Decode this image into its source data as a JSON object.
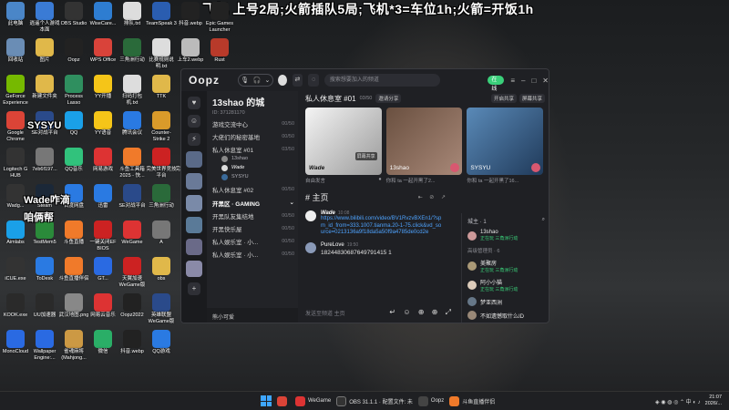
{
  "overlay_text": "飞机 上号2局;火箭插队5局;飞机*3=车位1h;火箭=开饭1h",
  "desktop_icons": [
    {
      "label": "此电脑",
      "color": "#4a86c8"
    },
    {
      "label": "逍遥个人游戏本面",
      "color": "#3a7bd5"
    },
    {
      "label": "OBS Studio",
      "color": "#333"
    },
    {
      "label": "WiseCare...",
      "color": "#2e7dd1"
    },
    {
      "label": "排队.txt",
      "color": "#ddd"
    },
    {
      "label": "TeamSpeak 3",
      "color": "#2a5db0"
    },
    {
      "label": "抖音.webp",
      "color": "#222"
    },
    {
      "label": "Epic Games Launcher",
      "color": "#222"
    },
    {
      "label": "回收站",
      "color": "#6a8db5"
    },
    {
      "label": "图片",
      "color": "#e0b84a"
    },
    {
      "label": "Oopz",
      "color": "#222"
    },
    {
      "label": "WPS Office",
      "color": "#d9433a"
    },
    {
      "label": "三角洲行动",
      "color": "#2a6a3a"
    },
    {
      "label": "比赛规则说明.txt",
      "color": "#ddd"
    },
    {
      "label": "上车2.webp",
      "color": "#bbb"
    },
    {
      "label": "Rust",
      "color": "#b83a2a"
    },
    {
      "label": "GeForce Experience",
      "color": "#76b900"
    },
    {
      "label": "新建文件夹",
      "color": "#e0b84a"
    },
    {
      "label": "Process Lasso",
      "color": "#2f8f5f"
    },
    {
      "label": "YY开播",
      "color": "#f5c518"
    },
    {
      "label": "扫码打包机.txt",
      "color": "#ddd"
    },
    {
      "label": "TTK",
      "color": "#e0b84a"
    },
    {
      "label": "Google Chrome",
      "color": "#db4437"
    },
    {
      "label": "SE对战平台",
      "color": "#2a4a8a"
    },
    {
      "label": "QQ",
      "color": "#1aa0e8"
    },
    {
      "label": "YY语音",
      "color": "#f5c518"
    },
    {
      "label": "腾讯会议",
      "color": "#2a7ae2"
    },
    {
      "label": "Counter-Strike 2",
      "color": "#d99a2a"
    },
    {
      "label": "Logitech G HUB",
      "color": "#333"
    },
    {
      "label": "7eb6f197...",
      "color": "#777"
    },
    {
      "label": "QQ音乐",
      "color": "#31c27c"
    },
    {
      "label": "网易游戏",
      "color": "#d33"
    },
    {
      "label": "斗鱼工具箱 2025 - 快...",
      "color": "#f07a2a"
    },
    {
      "label": "完美世界竞技平台",
      "color": "#c22"
    },
    {
      "label": "完美对战平台",
      "color": "#333"
    },
    {
      "label": "Wadg...",
      "color": "#333"
    },
    {
      "label": "Steam",
      "color": "#1b2838"
    },
    {
      "label": "百度网盘",
      "color": "#2a7ae2"
    },
    {
      "label": "迅雷",
      "color": "#2a7ae2"
    },
    {
      "label": "SE对战平台",
      "color": "#2a4a8a"
    },
    {
      "label": "三角洲行动",
      "color": "#2a6a3a"
    },
    {
      "label": "Aimlabs",
      "color": "#1aa0e8"
    },
    {
      "label": "TestMem5",
      "color": "#2a8a3a"
    },
    {
      "label": "斗鱼直播",
      "color": "#f07a2a"
    },
    {
      "label": "一键关闭EF BIOS",
      "color": "#c22"
    },
    {
      "label": "WeGame",
      "color": "#d33"
    },
    {
      "label": "A",
      "color": "#777"
    },
    {
      "label": "iCUE.exe",
      "color": "#333"
    },
    {
      "label": "ToDesk",
      "color": "#2a7ae2"
    },
    {
      "label": "斗鱼直播伴侣",
      "color": "#f07a2a"
    },
    {
      "label": "GT...",
      "color": "#2a6ae2"
    },
    {
      "label": "天翼加速WeGame版",
      "color": "#c22"
    },
    {
      "label": "obs",
      "color": "#e0b84a"
    },
    {
      "label": "KOOK.exe",
      "color": "#2a2a2a"
    },
    {
      "label": "UU加速器",
      "color": "#2a2a2a"
    },
    {
      "label": "武汉地图.png",
      "color": "#888"
    },
    {
      "label": "网易云音乐",
      "color": "#d33"
    },
    {
      "label": "Oopz2022",
      "color": "#222"
    },
    {
      "label": "英雄联盟WeGame版",
      "color": "#2a4a8a"
    },
    {
      "label": "比赛",
      "color": "#e0b84a"
    },
    {
      "label": "MonoCloud",
      "color": "#2a6ae2"
    },
    {
      "label": "Wallpaper Engine:...",
      "color": "#2a6ae2"
    },
    {
      "label": "雀魂麻将(Mahjong...",
      "color": "#c94"
    },
    {
      "label": "微信",
      "color": "#2aae67"
    },
    {
      "label": "抖音.webp",
      "color": "#222"
    },
    {
      "label": "QQ游戏",
      "color": "#2a7ae2"
    }
  ],
  "stream_labels": [
    "SYSYU",
    "Wade咋滴",
    "咱俩帮"
  ],
  "oopz": {
    "logo": "Oopz",
    "search_placeholder": "搜索想要加入的频道",
    "online_label": "在线",
    "server": {
      "name": "13shao 的城",
      "id": "ID: 371281170",
      "channels": [
        {
          "name": "游戏交流中心",
          "count": "00/50"
        },
        {
          "name": "大佬们的秘密基地",
          "count": "00/50"
        },
        {
          "name": "私人休息室 #01",
          "count": "03/50"
        }
      ],
      "members_in_room": [
        "13shao",
        "Wade",
        "SYSYU"
      ],
      "channels2": [
        {
          "name": "私人休息室 #02",
          "count": "00/50"
        }
      ],
      "category": "开黑区 · GAMING",
      "channels3": [
        {
          "name": "开黑队友集结地",
          "count": "00/50"
        },
        {
          "name": "开黑快乐屋",
          "count": "00/50"
        },
        {
          "name": "私人娱乐室 · 小...",
          "count": "00/50"
        },
        {
          "name": "私人娱乐室 · 小...",
          "count": "00/50"
        }
      ],
      "self_user": "熊小可爱"
    },
    "room": {
      "title": "私人休息室 #01",
      "capacity": "03/50",
      "share": "邀请分享",
      "actions": [
        "开启共享",
        "屏幕共享"
      ],
      "cams": [
        {
          "name": "Wade",
          "tag": "屏幕共享",
          "bg": "#e8e8e8"
        },
        {
          "name": "13shao",
          "tag": "",
          "bg": "#8a6a5a"
        },
        {
          "name": "SYSYU",
          "tag": "",
          "bg": "#3a6a9a"
        }
      ],
      "cam_captions": [
        {
          "left": "自由发言",
          "right": ""
        },
        {
          "left": "你和 ta 一起开黑了2...",
          "right": ""
        },
        {
          "left": "你和 ta 一起开黑了16...",
          "right": ""
        }
      ]
    },
    "chat": {
      "title": "主页",
      "messages": [
        {
          "author": "Wade",
          "time": "10:08",
          "link": "https://www.bilibili.com/video/BV1RvzvBXEn1/?spm_id_from=333.1007.tianma.20-1-75.click&vd_source=0213136a9f18da5a50f9a4785de0cd2e",
          "text": ""
        },
        {
          "author": "PureLove",
          "time": "19:50",
          "link": "",
          "text": "18244830687649791415 1"
        }
      ],
      "composer_placeholder": "发送至频道 主页"
    },
    "members": {
      "head": "城主 · 1",
      "owner": {
        "name": "13shao",
        "status": "正在玩 三角洲行动"
      },
      "section": "高级管理员 · 6",
      "list": [
        {
          "name": "美聚房",
          "status": "正在玩 三角洲行动"
        },
        {
          "name": "阿小小猫",
          "status": "正在玩 三角洲行动"
        },
        {
          "name": "梦亚西洲",
          "status": ""
        },
        {
          "name": "不如遗憾取什么ID",
          "status": ""
        }
      ]
    }
  },
  "taskbar": {
    "apps": [
      {
        "label": "WeGame",
        "color": "#d33"
      },
      {
        "label": "OBS 31.1.1 · 配置文件: 未",
        "color": "#333"
      },
      {
        "label": "Oopz",
        "color": "#222"
      },
      {
        "label": "斗鱼直播伴侣",
        "color": "#f07a2a"
      }
    ],
    "time": "21:07",
    "date": "2026/..."
  }
}
